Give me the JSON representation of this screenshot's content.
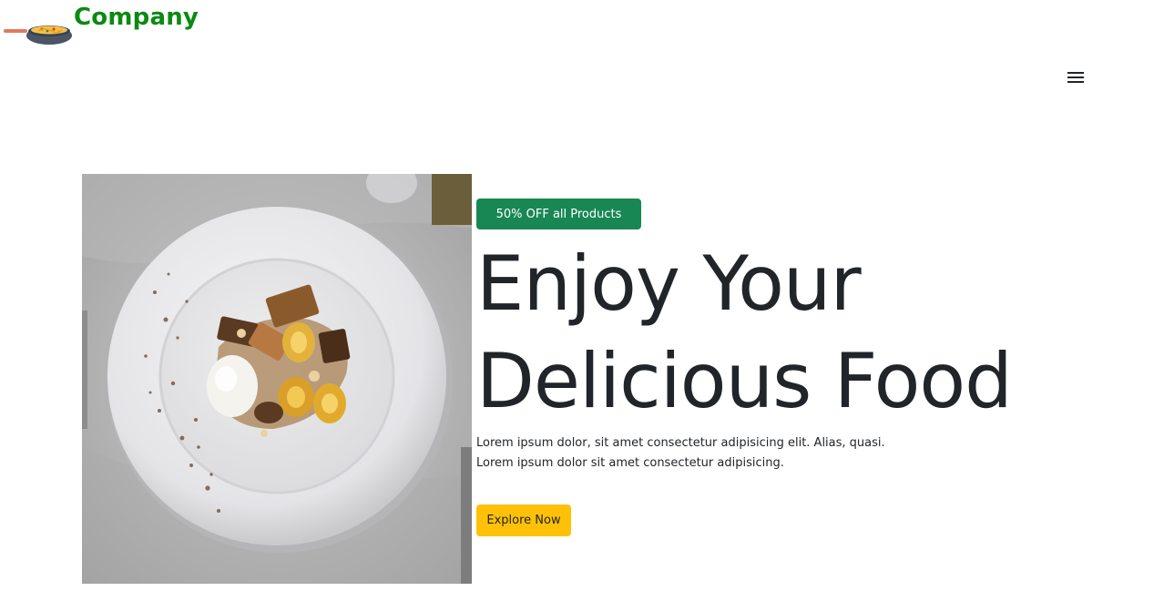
{
  "brand": {
    "name": "Company",
    "logo_icon": "frying-pan-icon",
    "color": "#0b8a12"
  },
  "nav": {
    "menu_icon": "hamburger-menu-icon"
  },
  "hero": {
    "image": "plated-dessert-photo",
    "badge": "50% OFF all Products",
    "headline_line1": "Enjoy Your",
    "headline_line2": "Delicious Food",
    "description_line1": "Lorem ipsum dolor, sit amet consectetur adipisicing elit. Alias, quasi.",
    "description_line2": "Lorem ipsum dolor sit amet consectetur adipisicing.",
    "cta_label": "Explore Now"
  },
  "colors": {
    "badge_bg": "#198754",
    "cta_bg": "#ffc107",
    "text": "#212529"
  }
}
